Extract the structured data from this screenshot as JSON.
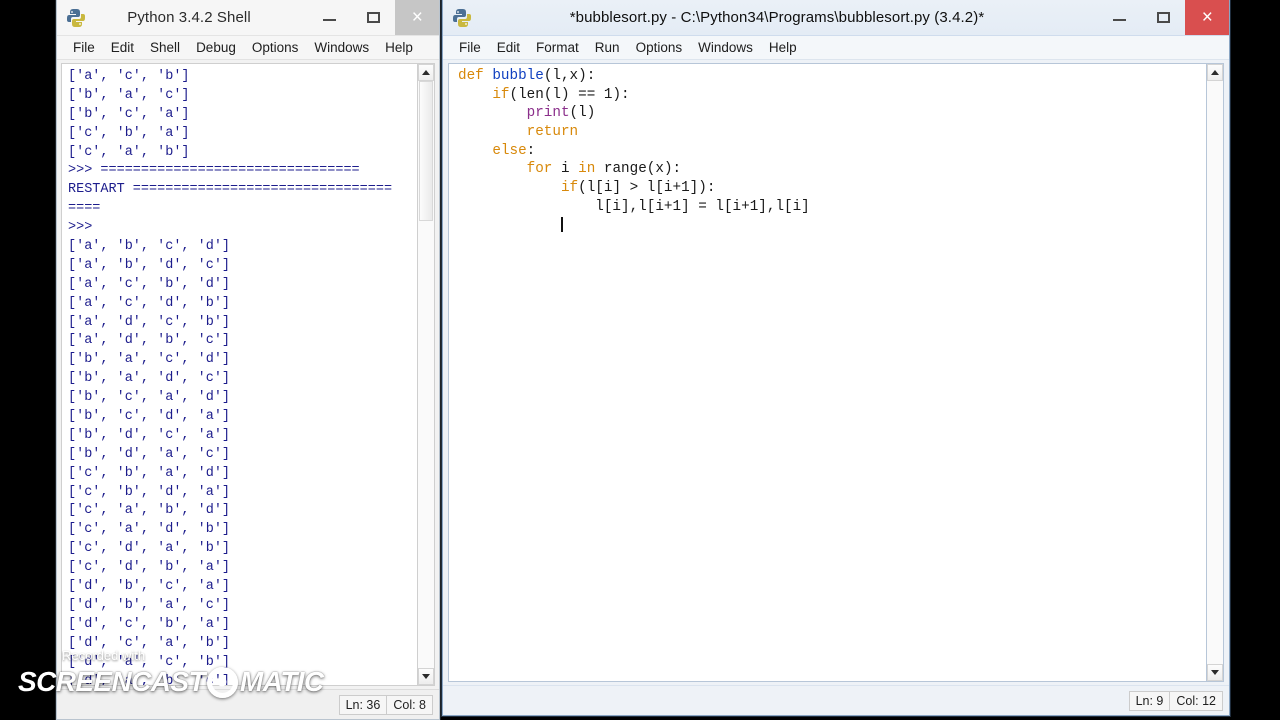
{
  "shell_window": {
    "title": "Python 3.4.2 Shell",
    "icon": "python-idle-icon",
    "active": false,
    "buttons": {
      "minimize": "—",
      "maximize": "☐",
      "close": "×"
    },
    "menu": [
      "File",
      "Edit",
      "Shell",
      "Debug",
      "Options",
      "Windows",
      "Help"
    ],
    "status": {
      "line": "Ln: 36",
      "col": "Col: 8"
    },
    "lines": [
      "['a', 'c', 'b']",
      "['b', 'a', 'c']",
      "['b', 'c', 'a']",
      "['c', 'b', 'a']",
      "['c', 'a', 'b']",
      ">>> ================================",
      "RESTART ================================",
      "====",
      ">>>",
      "['a', 'b', 'c', 'd']",
      "['a', 'b', 'd', 'c']",
      "['a', 'c', 'b', 'd']",
      "['a', 'c', 'd', 'b']",
      "['a', 'd', 'c', 'b']",
      "['a', 'd', 'b', 'c']",
      "['b', 'a', 'c', 'd']",
      "['b', 'a', 'd', 'c']",
      "['b', 'c', 'a', 'd']",
      "['b', 'c', 'd', 'a']",
      "['b', 'd', 'c', 'a']",
      "['b', 'd', 'a', 'c']",
      "['c', 'b', 'a', 'd']",
      "['c', 'b', 'd', 'a']",
      "['c', 'a', 'b', 'd']",
      "['c', 'a', 'd', 'b']",
      "['c', 'd', 'a', 'b']",
      "['c', 'd', 'b', 'a']",
      "['d', 'b', 'c', 'a']",
      "['d', 'b', 'a', 'c']",
      "['d', 'c', 'b', 'a']",
      "['d', 'c', 'a', 'b']",
      "['d', 'a', 'c', 'b']",
      "['d', 'a', 'b', 'c']"
    ]
  },
  "editor_window": {
    "title": "*bubblesort.py - C:\\Python34\\Programs\\bubblesort.py (3.4.2)*",
    "icon": "python-idle-icon",
    "active": true,
    "buttons": {
      "minimize": "—",
      "maximize": "☐",
      "close": "×"
    },
    "menu": [
      "File",
      "Edit",
      "Format",
      "Run",
      "Options",
      "Windows",
      "Help"
    ],
    "status": {
      "line": "Ln: 9",
      "col": "Col: 12"
    },
    "code_lines": [
      [
        {
          "t": "def ",
          "c": "kw"
        },
        {
          "t": "bubble",
          "c": "def"
        },
        {
          "t": "(l,x):",
          "c": "plain"
        }
      ],
      [
        {
          "t": "    ",
          "c": "plain"
        },
        {
          "t": "if",
          "c": "kw"
        },
        {
          "t": "(len(l) == 1):",
          "c": "plain"
        }
      ],
      [
        {
          "t": "        ",
          "c": "plain"
        },
        {
          "t": "print",
          "c": "builtin"
        },
        {
          "t": "(l)",
          "c": "plain"
        }
      ],
      [
        {
          "t": "        ",
          "c": "plain"
        },
        {
          "t": "return",
          "c": "kw"
        }
      ],
      [
        {
          "t": "    ",
          "c": "plain"
        },
        {
          "t": "else",
          "c": "kw"
        },
        {
          "t": ":",
          "c": "plain"
        }
      ],
      [
        {
          "t": "        ",
          "c": "plain"
        },
        {
          "t": "for",
          "c": "kw"
        },
        {
          "t": " i ",
          "c": "plain"
        },
        {
          "t": "in",
          "c": "kw"
        },
        {
          "t": " range(x):",
          "c": "plain"
        }
      ],
      [
        {
          "t": "            ",
          "c": "plain"
        },
        {
          "t": "if",
          "c": "kw"
        },
        {
          "t": "(l[i] > l[i+1]):",
          "c": "plain"
        }
      ],
      [
        {
          "t": "                l[i],l[i+1] = l[i+1],l[i]",
          "c": "plain"
        }
      ],
      [
        {
          "t": "            ",
          "c": "plain"
        },
        {
          "t": "",
          "c": "caret"
        }
      ]
    ]
  },
  "watermark": {
    "recorded_label": "Recorded with",
    "brand_part1": "SCREENCAST",
    "brand_icon": "circle-o-icon",
    "brand_part2": "MATIC"
  },
  "colors": {
    "shell_text": "#1c1c8c",
    "keyword": "#d8890b",
    "definition": "#1040c0",
    "builtin": "#8b2f8b",
    "active_close": "#d94f4f",
    "inactive_close": "#c6c6c6"
  }
}
